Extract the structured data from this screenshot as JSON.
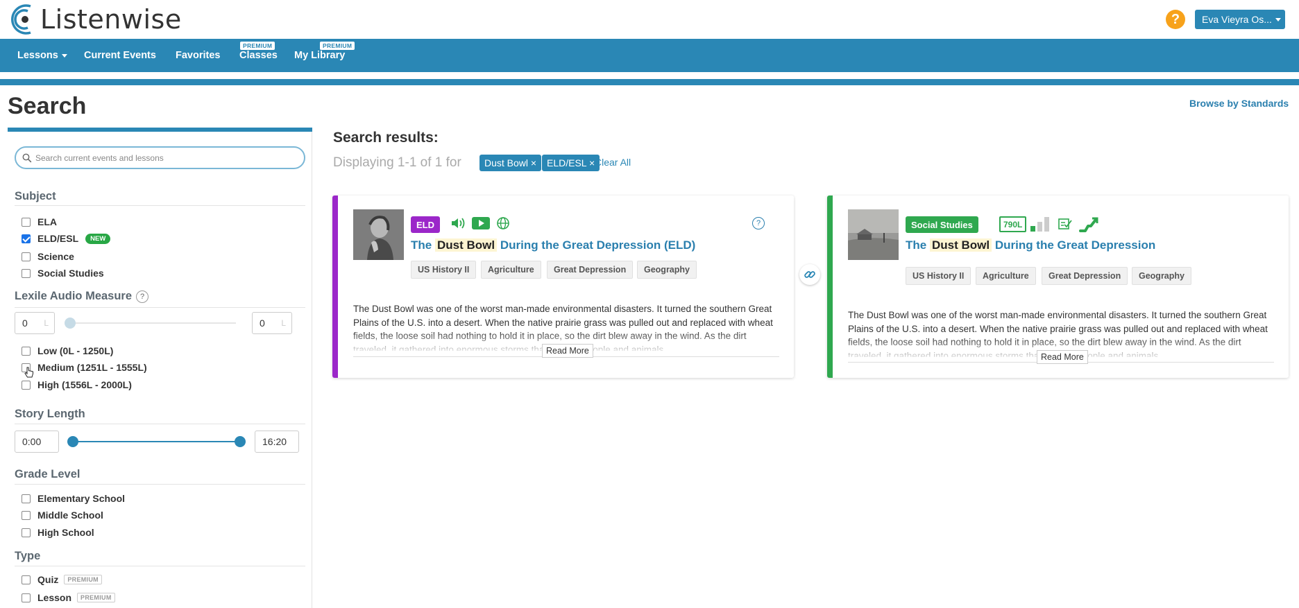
{
  "app": {
    "logo_text": "Listenwise"
  },
  "header": {
    "help_symbol": "?",
    "user_label": "Eva Vieyra Os..."
  },
  "nav": {
    "items": [
      {
        "label": "Lessons"
      },
      {
        "label": "Current Events"
      },
      {
        "label": "Favorites"
      },
      {
        "label": "Classes",
        "badge": "PREMIUM"
      },
      {
        "label": "My Library",
        "badge": "PREMIUM"
      }
    ]
  },
  "page": {
    "title": "Search",
    "browse_link": "Browse by Standards"
  },
  "sidebar": {
    "search": {
      "placeholder": "Search current events and lessons",
      "value": ""
    },
    "subject": {
      "title": "Subject",
      "items": [
        {
          "label": "ELA",
          "checked": false
        },
        {
          "label": "ELD/ESL",
          "checked": true,
          "badge": "NEW"
        },
        {
          "label": "Science",
          "checked": false
        },
        {
          "label": "Social Studies",
          "checked": false
        }
      ]
    },
    "lexile": {
      "title": "Lexile Audio Measure",
      "help": "?",
      "min_value": "0",
      "max_value": "0",
      "unit": "L",
      "items": [
        {
          "label": "Low (0L - 1250L)",
          "checked": false
        },
        {
          "label": "Medium (1251L - 1555L)",
          "checked": false
        },
        {
          "label": "High (1556L - 2000L)",
          "checked": false
        }
      ]
    },
    "story_length": {
      "title": "Story Length",
      "min_value": "0:00",
      "max_value": "16:20"
    },
    "grade": {
      "title": "Grade Level",
      "items": [
        {
          "label": "Elementary School",
          "checked": false
        },
        {
          "label": "Middle School",
          "checked": false
        },
        {
          "label": "High School",
          "checked": false
        }
      ]
    },
    "type": {
      "title": "Type",
      "items": [
        {
          "label": "Quiz",
          "checked": false,
          "badge": "PREMIUM"
        },
        {
          "label": "Lesson",
          "checked": false,
          "badge": "PREMIUM"
        }
      ]
    }
  },
  "results": {
    "title": "Search results:",
    "displaying": "Displaying 1-1 of 1 for",
    "filters": [
      {
        "label": "Dust Bowl ×"
      },
      {
        "label": "ELD/ESL ×"
      }
    ],
    "clear_all": "Clear All",
    "cards": [
      {
        "tag": "ELD",
        "title_pre": "The",
        "title_hl": "Dust Bowl",
        "title_post": "During the Great Depression (ELD)",
        "help": "?",
        "topics": [
          "US History II",
          "Agriculture",
          "Great Depression",
          "Geography"
        ],
        "description": "The Dust Bowl was one of the worst man-made environmental disasters. It turned the southern Great Plains of the U.S. into a desert. When the native prairie grass was pulled out and replaced with wheat fields, the loose soil had nothing to hold it in place, so the dirt blew away in the wind. As the dirt traveled, it gathered into enormous storms that choked people and animals.",
        "read_more": "Read More"
      },
      {
        "tag": "Social Studies",
        "lexile": "790L",
        "title_pre": "The",
        "title_hl": "Dust Bowl",
        "title_post": "During the Great Depression",
        "topics": [
          "US History II",
          "Agriculture",
          "Great Depression",
          "Geography"
        ],
        "description": "The Dust Bowl was one of the worst man-made environmental disasters. It turned the southern Great Plains of the U.S. into a desert. When the native prairie grass was pulled out and replaced with wheat fields, the loose soil had nothing to hold it in place, so the dirt blew away in the wind. As the dirt traveled, it gathered into enormous storms that choked people and animals.",
        "read_more": "Read More"
      }
    ]
  },
  "colors": {
    "brand_blue": "#2a87b5",
    "eld_purple": "#9b27c9",
    "social_green": "#2fa84f",
    "help_orange": "#f7a21b"
  }
}
